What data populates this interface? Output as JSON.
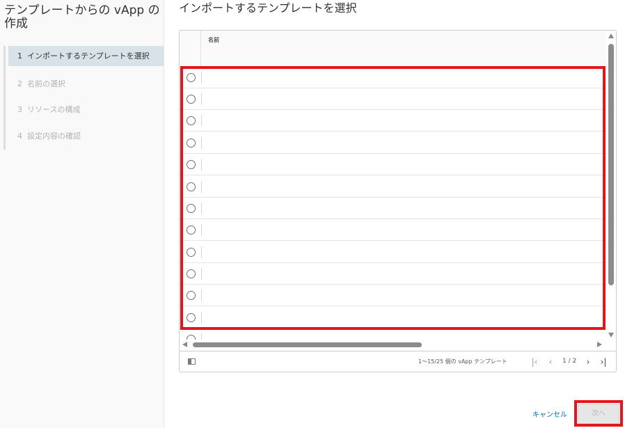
{
  "wizard": {
    "title": "テンプレートからの vApp の作成",
    "steps": [
      {
        "num": "1",
        "label": "インポートするテンプレートを選択",
        "state": "active"
      },
      {
        "num": "2",
        "label": "名前の選択",
        "state": "disabled"
      },
      {
        "num": "3",
        "label": "リソースの構成",
        "state": "disabled"
      },
      {
        "num": "4",
        "label": "設定内容の確認",
        "state": "disabled"
      }
    ]
  },
  "main": {
    "title": "インポートするテンプレートを選択",
    "grid": {
      "columns": [
        "名前"
      ],
      "rows": [
        {
          "name": "",
          "selected": false
        },
        {
          "name": "",
          "selected": false
        },
        {
          "name": "",
          "selected": false
        },
        {
          "name": "",
          "selected": false
        },
        {
          "name": "",
          "selected": false
        },
        {
          "name": "",
          "selected": false
        },
        {
          "name": "",
          "selected": false
        },
        {
          "name": "",
          "selected": false
        },
        {
          "name": "",
          "selected": false
        },
        {
          "name": "",
          "selected": false
        },
        {
          "name": "",
          "selected": false
        },
        {
          "name": "",
          "selected": false
        },
        {
          "name": "",
          "selected": false
        }
      ],
      "footer": {
        "count": "1～15/25 個の vApp テンプレート",
        "page": "1 / 2",
        "first_icon": "first-page-icon",
        "prev_icon": "chevron-left-icon",
        "next_icon": "chevron-right-icon",
        "last_icon": "last-page-icon"
      }
    }
  },
  "actions": {
    "cancel": "キャンセル",
    "next": "次へ"
  },
  "colors": {
    "accent": "#0072a3",
    "active_step_bg": "#d8e3e9",
    "highlight": "#e2161d"
  }
}
